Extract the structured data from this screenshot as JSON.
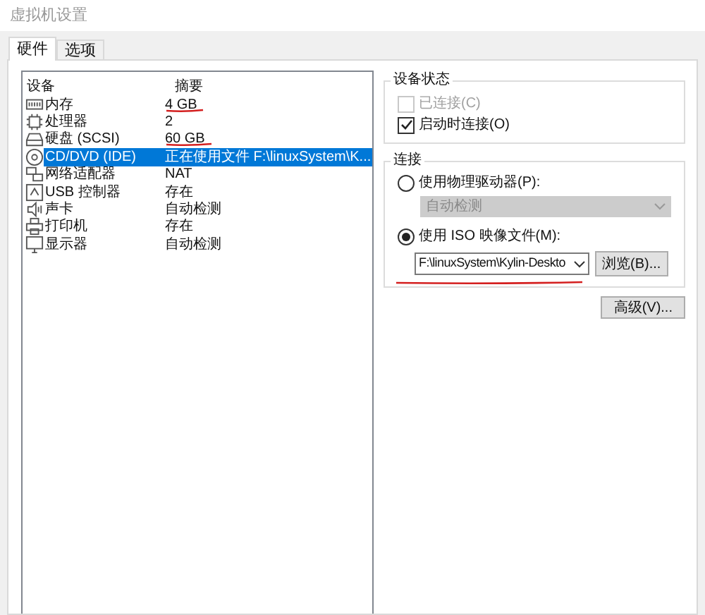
{
  "window": {
    "title": "虚拟机设置"
  },
  "tabs": [
    {
      "label": "硬件",
      "selected": true
    },
    {
      "label": "选项",
      "selected": false
    }
  ],
  "devices": {
    "columns": [
      "设备",
      "摘要"
    ],
    "rows": [
      {
        "kind": "memory",
        "name": "内存",
        "summary": "4 GB",
        "selected": false,
        "underlined": true
      },
      {
        "kind": "cpu",
        "name": "处理器",
        "summary": "2",
        "selected": false,
        "underlined": false
      },
      {
        "kind": "disk",
        "name": "硬盘 (SCSI)",
        "summary": "60 GB",
        "selected": false,
        "underlined": true
      },
      {
        "kind": "cd",
        "name": "CD/DVD (IDE)",
        "summary": "正在使用文件 F:\\linuxSystem\\K...",
        "selected": true,
        "underlined": false
      },
      {
        "kind": "network",
        "name": "网络适配器",
        "summary": "NAT",
        "selected": false,
        "underlined": false
      },
      {
        "kind": "usb",
        "name": "USB 控制器",
        "summary": "存在",
        "selected": false,
        "underlined": false
      },
      {
        "kind": "sound",
        "name": "声卡",
        "summary": "自动检测",
        "selected": false,
        "underlined": false
      },
      {
        "kind": "printer",
        "name": "打印机",
        "summary": "存在",
        "selected": false,
        "underlined": false
      },
      {
        "kind": "display",
        "name": "显示器",
        "summary": "自动检测",
        "selected": false,
        "underlined": false
      }
    ]
  },
  "device_status": {
    "title": "设备状态",
    "options": [
      {
        "label": "已连接(C)",
        "checked": false,
        "disabled": true
      },
      {
        "label": "启动时连接(O)",
        "checked": true,
        "disabled": false
      }
    ]
  },
  "connection": {
    "title": "连接",
    "physical": {
      "label": "使用物理驱动器(P):",
      "selected": false,
      "dropdown": {
        "value": "自动检测",
        "disabled": true
      }
    },
    "iso": {
      "label": "使用 ISO 映像文件(M):",
      "selected": true,
      "value": "F:\\linuxSystem\\Kylin-Deskto",
      "underlined": true,
      "browse": "浏览(B)..."
    }
  },
  "advanced_button": "高级(V)..."
}
